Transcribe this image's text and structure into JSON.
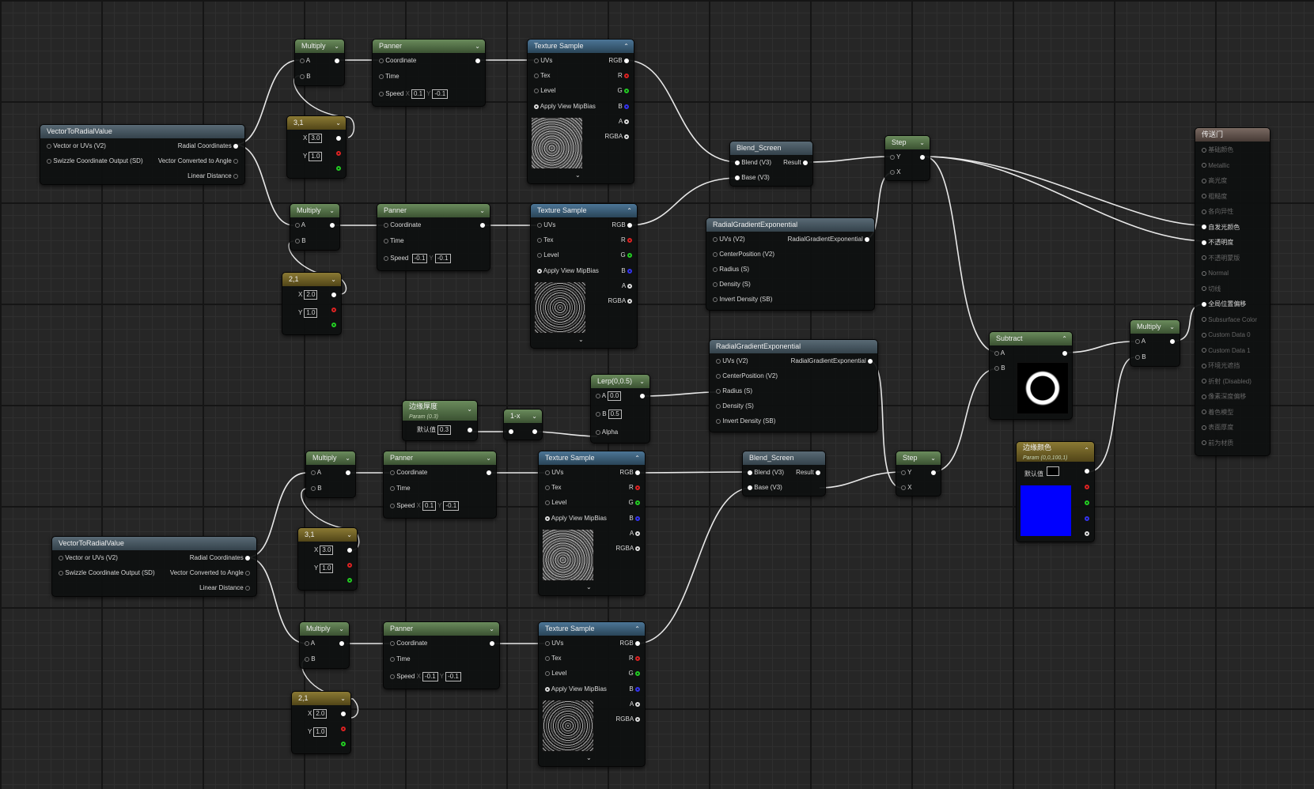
{
  "nodes": {
    "v2r1": {
      "title": "VectorToRadialValue",
      "in1": "Vector or UVs (V2)",
      "in2": "Swizzle Coordinate Output (SD)",
      "out1": "Radial Coordinates",
      "out2": "Vector Converted to Angle",
      "out3": "Linear Distance"
    },
    "v2r2": {
      "title": "VectorToRadialValue",
      "in1": "Vector or UVs (V2)",
      "in2": "Swizzle Coordinate Output (SD)",
      "out1": "Radial Coordinates",
      "out2": "Vector Converted to Angle",
      "out3": "Linear Distance"
    },
    "mul1": {
      "title": "Multiply",
      "a": "A",
      "b": "B"
    },
    "mul2": {
      "title": "Multiply",
      "a": "A",
      "b": "B"
    },
    "mul3": {
      "title": "Multiply",
      "a": "A",
      "b": "B"
    },
    "mul4": {
      "title": "Multiply",
      "a": "A",
      "b": "B"
    },
    "mul5": {
      "title": "Multiply",
      "a": "A",
      "b": "B"
    },
    "c31a": {
      "title": "3,1",
      "xl": "X",
      "x": "3.0",
      "yl": "Y",
      "y": "1.0"
    },
    "c21a": {
      "title": "2,1",
      "xl": "X",
      "x": "2.0",
      "yl": "Y",
      "y": "1.0"
    },
    "c31b": {
      "title": "3,1",
      "xl": "X",
      "x": "3.0",
      "yl": "Y",
      "y": "1.0"
    },
    "c21b": {
      "title": "2,1",
      "xl": "X",
      "x": "2.0",
      "yl": "Y",
      "y": "1.0"
    },
    "pan1": {
      "title": "Panner",
      "coord": "Coordinate",
      "time": "Time",
      "speed": "Speed",
      "xl": "X",
      "x": "0.1",
      "yl": "Y",
      "y": "-0.1"
    },
    "pan2": {
      "title": "Panner",
      "coord": "Coordinate",
      "time": "Time",
      "speed": "Speed",
      "xl": "X",
      "x": "-0.1",
      "yl": "Y",
      "y": "-0.1"
    },
    "pan3": {
      "title": "Panner",
      "coord": "Coordinate",
      "time": "Time",
      "speed": "Speed",
      "xl": "X",
      "x": "0.1",
      "yl": "Y",
      "y": "-0.1"
    },
    "pan4": {
      "title": "Panner",
      "coord": "Coordinate",
      "time": "Time",
      "speed": "Speed",
      "xl": "X",
      "x": "-0.1",
      "yl": "Y",
      "y": "-0.1"
    },
    "tex1": {
      "title": "Texture Sample",
      "uvs": "UVs",
      "tex": "Tex",
      "level": "Level",
      "mip": "Apply View MipBias",
      "rgb": "RGB",
      "r": "R",
      "g": "G",
      "bb": "B",
      "a": "A",
      "rgba": "RGBA"
    },
    "tex2": {
      "title": "Texture Sample",
      "uvs": "UVs",
      "tex": "Tex",
      "level": "Level",
      "mip": "Apply View MipBias",
      "rgb": "RGB",
      "r": "R",
      "g": "G",
      "bb": "B",
      "a": "A",
      "rgba": "RGBA"
    },
    "tex3": {
      "title": "Texture Sample",
      "uvs": "UVs",
      "tex": "Tex",
      "level": "Level",
      "mip": "Apply View MipBias",
      "rgb": "RGB",
      "r": "R",
      "g": "G",
      "bb": "B",
      "a": "A",
      "rgba": "RGBA"
    },
    "tex4": {
      "title": "Texture Sample",
      "uvs": "UVs",
      "tex": "Tex",
      "level": "Level",
      "mip": "Apply View MipBias",
      "rgb": "RGB",
      "r": "R",
      "g": "G",
      "bb": "B",
      "a": "A",
      "rgba": "RGBA"
    },
    "blend1": {
      "title": "Blend_Screen",
      "blend": "Blend (V3)",
      "base": "Base (V3)",
      "result": "Result"
    },
    "blend2": {
      "title": "Blend_Screen",
      "blend": "Blend (V3)",
      "base": "Base (V3)",
      "result": "Result"
    },
    "rge1": {
      "title": "RadialGradientExponential",
      "uvs": "UVs (V2)",
      "center": "CenterPosition (V2)",
      "radius": "Radius (S)",
      "density": "Density (S)",
      "invert": "Invert Density (SB)",
      "out": "RadialGradientExponential"
    },
    "rge2": {
      "title": "RadialGradientExponential",
      "uvs": "UVs (V2)",
      "center": "CenterPosition (V2)",
      "radius": "Radius (S)",
      "density": "Density (S)",
      "invert": "Invert Density (SB)",
      "out": "RadialGradientExponential"
    },
    "step1": {
      "title": "Step",
      "y": "Y",
      "x": "X"
    },
    "step2": {
      "title": "Step",
      "y": "Y",
      "x": "X"
    },
    "subtract": {
      "title": "Subtract",
      "a": "A",
      "b": "B"
    },
    "edge": {
      "title": "边缘厚度",
      "sub": "Param (0.3)",
      "label": "默认值",
      "value": "0.3"
    },
    "onex": {
      "title": "1-x"
    },
    "lerp": {
      "title": "Lerp(0,0.5)",
      "a": "A",
      "av": "0.0",
      "b": "B",
      "bv": "0.5",
      "alpha": "Alpha"
    },
    "edgecolor": {
      "title": "边缘颜色",
      "sub": "Param (0,0,100,1)",
      "label": "默认值"
    },
    "output": {
      "title": "传送门",
      "pins": [
        "基础颜色",
        "Metallic",
        "高光度",
        "粗糙度",
        "各向异性",
        "自发光颜色",
        "不透明度",
        "不透明蒙版",
        "Normal",
        "切线",
        "全局位置偏移",
        "Subsurface Color",
        "Custom Data 0",
        "Custom Data 1",
        "环境光遮挡",
        "折射 (Disabled)",
        "像素深度偏移",
        "着色模型",
        "表面厚度",
        "前为材质"
      ]
    }
  },
  "colors": {
    "material": "#8b6e62",
    "param": "#5a7a46",
    "constant": "#8b7a34",
    "texture": "#345a79",
    "function": "#3b5568",
    "edge_color": "#0000ff"
  }
}
